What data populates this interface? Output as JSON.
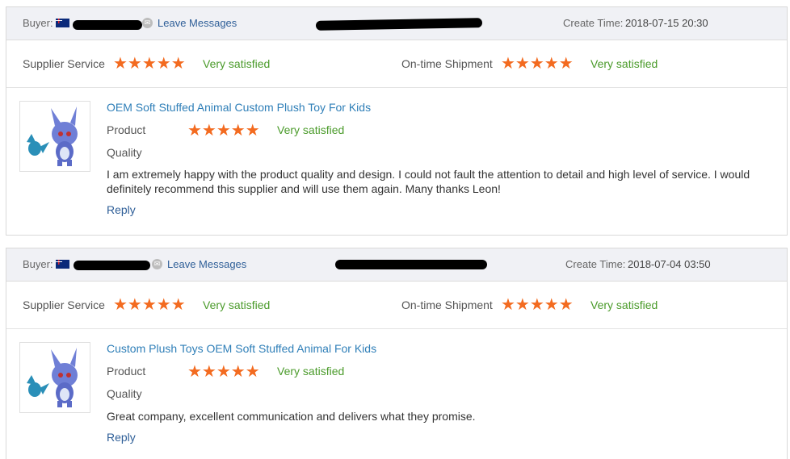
{
  "reviews": [
    {
      "buyer_label": "Buyer:",
      "leave_messages": "Leave Messages",
      "create_time_label": "Create Time:",
      "create_time": "2018-07-15 20:30",
      "supplier_service_label": "Supplier Service",
      "supplier_service_rating": "Very satisfied",
      "ontime_label": "On-time Shipment",
      "ontime_rating": "Very satisfied",
      "product_title": "OEM Soft Stuffed Animal Custom Plush Toy For Kids",
      "product_label": "Product",
      "product_rating": "Very satisfied",
      "quality_label": "Quality",
      "review_text": "I am extremely happy with the product quality and design. I could not fault the attention to detail and high level of service. I would definitely recommend this supplier and will use them again. Many thanks Leon!",
      "reply_label": "Reply"
    },
    {
      "buyer_label": "Buyer:",
      "leave_messages": "Leave Messages",
      "create_time_label": "Create Time:",
      "create_time": "2018-07-04 03:50",
      "supplier_service_label": "Supplier Service",
      "supplier_service_rating": "Very satisfied",
      "ontime_label": "On-time Shipment",
      "ontime_rating": "Very satisfied",
      "product_title": "Custom Plush Toys OEM Soft Stuffed Animal For Kids",
      "product_label": "Product",
      "product_rating": "Very satisfied",
      "quality_label": "Quality",
      "review_text": "Great company, excellent communication and delivers what they promise.",
      "reply_label": "Reply"
    }
  ],
  "stars": "★★★★★",
  "colors": {
    "star": "#f36b20",
    "satisfied": "#4b9b2b",
    "link": "#2f5f98"
  },
  "icons": {
    "flag": "australia-flag-icon",
    "message": "message-icon",
    "star": "star-icon"
  }
}
